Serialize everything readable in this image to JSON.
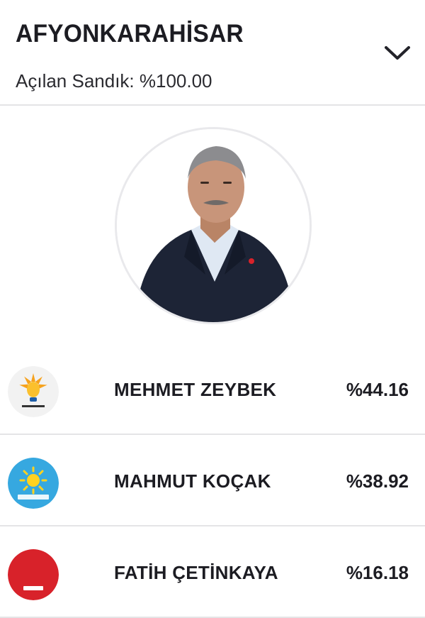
{
  "header": {
    "city": "AFYONKARAHİSAR",
    "opened_ballots": "Açılan Sandık: %100.00",
    "expand_icon": "chevron-down-icon"
  },
  "winner_photo": {
    "icon": "candidate-portrait"
  },
  "results": [
    {
      "party_logo": "akp-logo",
      "name": "MEHMET ZEYBEK",
      "percent": "%44.16",
      "vote_share": 44.16
    },
    {
      "party_logo": "iyi-parti-logo",
      "name": "MAHMUT KOÇAK",
      "percent": "%38.92",
      "vote_share": 38.92
    },
    {
      "party_logo": "mhp-logo",
      "name": "FATİH ÇETİNKAYA",
      "percent": "%16.18",
      "vote_share": 16.18
    }
  ],
  "colors": {
    "akp_orange": "#f6a21d",
    "akp_blue": "#1f5ea8",
    "iyi_blue": "#36a8e0",
    "iyi_sun": "#ffd21f",
    "mhp_red": "#d8222a",
    "divider": "#e4e4e6"
  }
}
